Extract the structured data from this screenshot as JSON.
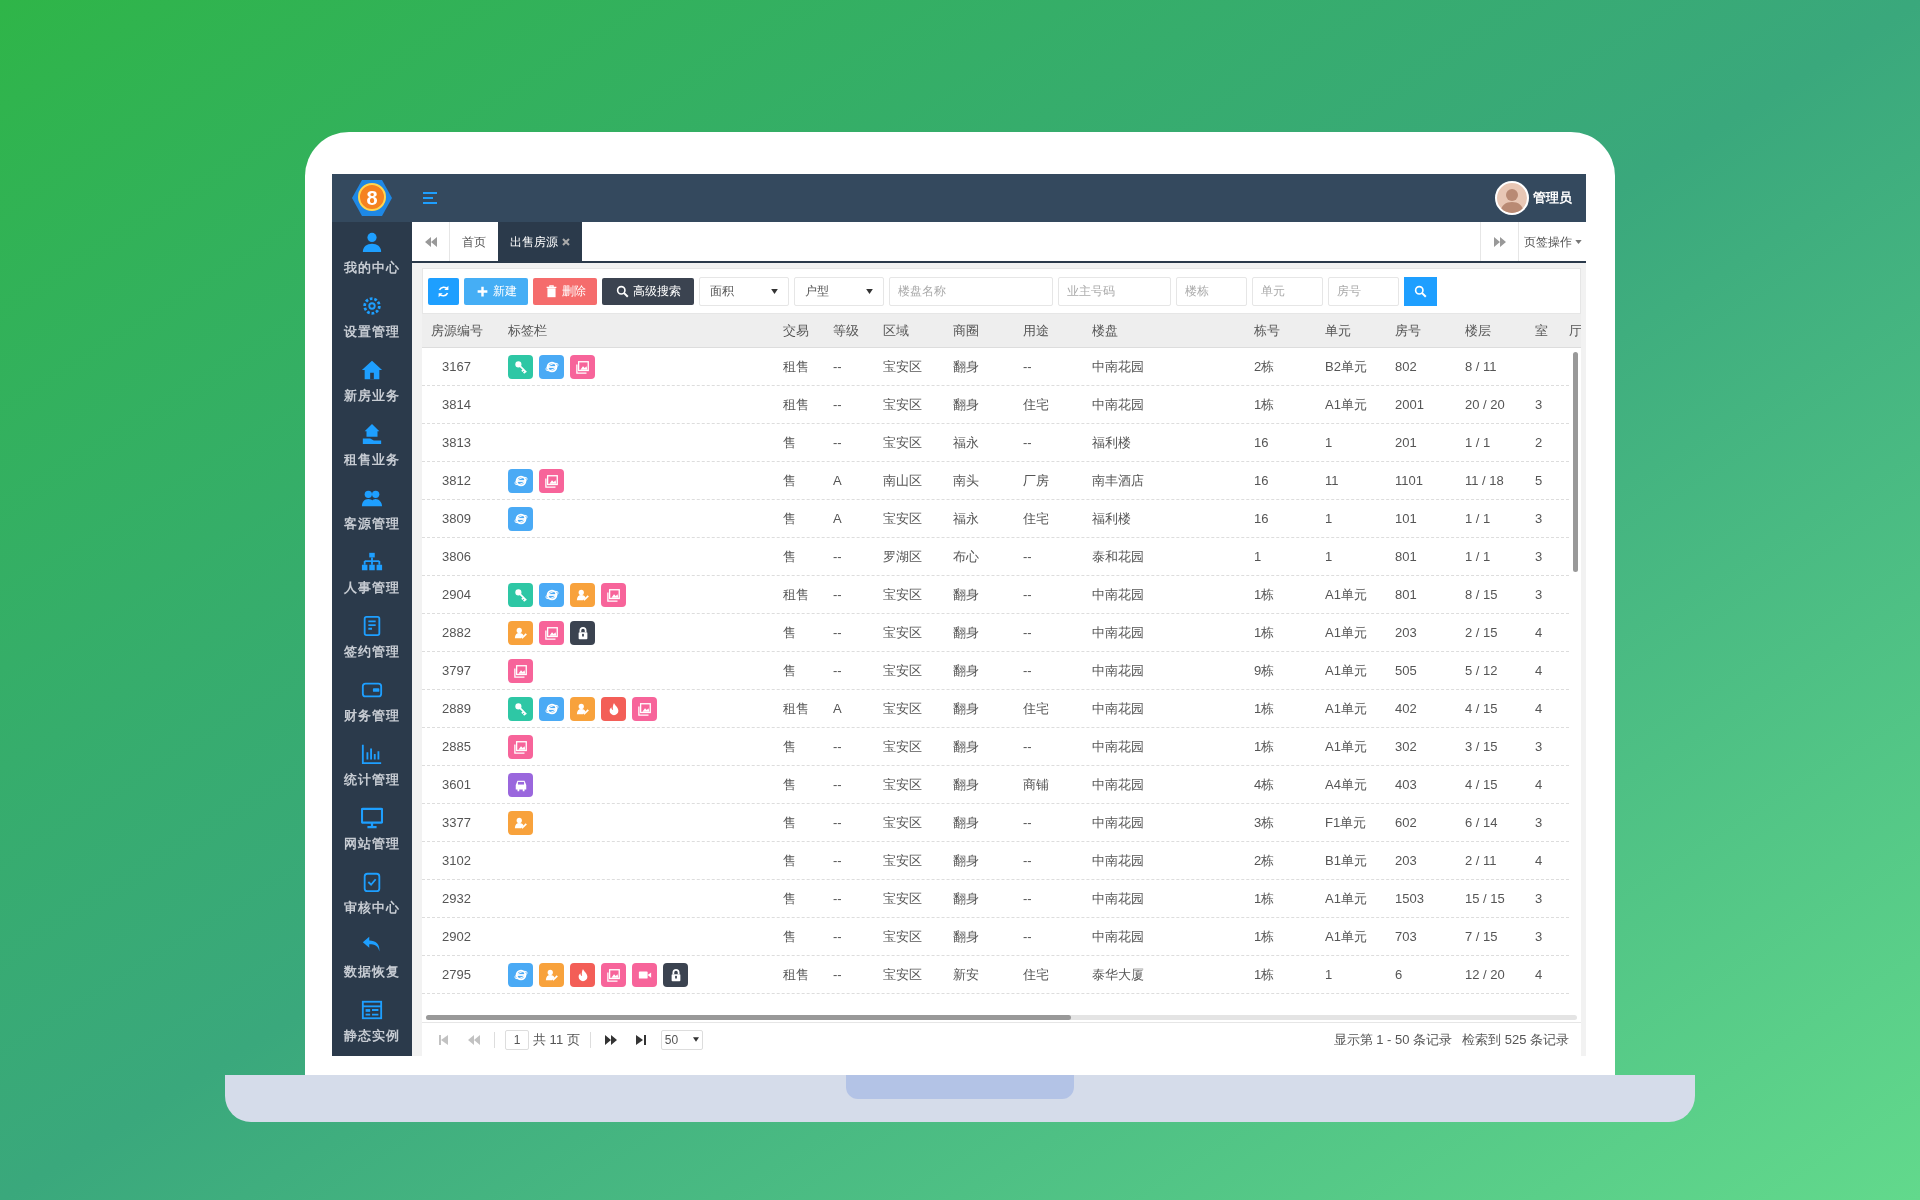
{
  "header": {
    "logo_text": "8",
    "user_name": "管理员"
  },
  "sidebar": {
    "items": [
      {
        "label": "我的中心"
      },
      {
        "label": "设置管理"
      },
      {
        "label": "新房业务"
      },
      {
        "label": "租售业务"
      },
      {
        "label": "客源管理"
      },
      {
        "label": "人事管理"
      },
      {
        "label": "签约管理"
      },
      {
        "label": "财务管理"
      },
      {
        "label": "统计管理"
      },
      {
        "label": "网站管理"
      },
      {
        "label": "审核中心"
      },
      {
        "label": "数据恢复"
      },
      {
        "label": "静态实例"
      }
    ]
  },
  "tabs": [
    {
      "label": "首页",
      "selected": false,
      "closable": false
    },
    {
      "label": "出售房源",
      "selected": true,
      "closable": true
    }
  ],
  "tab_actions": {
    "label": "页签操作"
  },
  "toolbar": {
    "buttons": [
      {
        "kind": "refresh"
      },
      {
        "kind": "new",
        "label": "新建"
      },
      {
        "kind": "delete",
        "label": "删除"
      },
      {
        "kind": "advanced",
        "label": "高级搜索"
      }
    ],
    "selects": [
      {
        "value": "面积"
      },
      {
        "value": "户型"
      }
    ],
    "inputs": [
      {
        "placeholder": "楼盘名称"
      },
      {
        "placeholder": "业主号码"
      },
      {
        "placeholder": "楼栋"
      },
      {
        "placeholder": "单元"
      },
      {
        "placeholder": "房号"
      }
    ]
  },
  "table": {
    "columns": [
      "房源编号",
      "标签栏",
      "交易",
      "等级",
      "区域",
      "商圈",
      "用途",
      "楼盘",
      "栋号",
      "单元",
      "房号",
      "楼层",
      "室",
      "厅"
    ],
    "rows": [
      {
        "cells": [
          "3167",
          {
            "kind": "tag_list",
            "tags": [
              {
                "kind": "key"
              },
              {
                "kind": "ie"
              },
              {
                "kind": "image"
              }
            ]
          },
          "租售",
          "--",
          "宝安区",
          "翻身",
          "--",
          "中南花园",
          "2栋",
          "B2单元",
          "802",
          "8 / 11"
        ]
      },
      {
        "cells": [
          "3814",
          {
            "kind": "tag_list"
          },
          "租售",
          "--",
          "宝安区",
          "翻身",
          "住宅",
          "中南花园",
          "1栋",
          "A1单元",
          "2001",
          "20 / 20",
          "3"
        ]
      },
      {
        "cells": [
          "3813",
          {
            "kind": "tag_list"
          },
          "售",
          "--",
          "宝安区",
          "福永",
          "--",
          "福利楼",
          "16",
          "1",
          "201",
          "1 / 1",
          "2"
        ]
      },
      {
        "cells": [
          "3812",
          {
            "kind": "tag_list",
            "tags": [
              {
                "kind": "ie"
              },
              {
                "kind": "image"
              }
            ]
          },
          "售",
          "A",
          "南山区",
          "南头",
          "厂房",
          "南丰酒店",
          "16",
          "11",
          "1101",
          "11 / 18",
          "5"
        ]
      },
      {
        "cells": [
          "3809",
          {
            "kind": "tag_list",
            "tags": [
              {
                "kind": "ie"
              }
            ]
          },
          "售",
          "A",
          "宝安区",
          "福永",
          "住宅",
          "福利楼",
          "16",
          "1",
          "101",
          "1 / 1",
          "3"
        ]
      },
      {
        "cells": [
          "3806",
          {
            "kind": "tag_list"
          },
          "售",
          "--",
          "罗湖区",
          "布心",
          "--",
          "泰和花园",
          "1",
          "1",
          "801",
          "1 / 1",
          "3"
        ]
      },
      {
        "cells": [
          "2904",
          {
            "kind": "tag_list",
            "tags": [
              {
                "kind": "key"
              },
              {
                "kind": "ie"
              },
              {
                "kind": "person"
              },
              {
                "kind": "image"
              }
            ]
          },
          "租售",
          "--",
          "宝安区",
          "翻身",
          "--",
          "中南花园",
          "1栋",
          "A1单元",
          "801",
          "8 / 15",
          "3"
        ]
      },
      {
        "cells": [
          "2882",
          {
            "kind": "tag_list",
            "tags": [
              {
                "kind": "person"
              },
              {
                "kind": "image"
              },
              {
                "kind": "lock"
              }
            ]
          },
          "售",
          "--",
          "宝安区",
          "翻身",
          "--",
          "中南花园",
          "1栋",
          "A1单元",
          "203",
          "2 / 15",
          "4"
        ]
      },
      {
        "cells": [
          "3797",
          {
            "kind": "tag_list",
            "tags": [
              {
                "kind": "image"
              }
            ]
          },
          "售",
          "--",
          "宝安区",
          "翻身",
          "--",
          "中南花园",
          "9栋",
          "A1单元",
          "505",
          "5 / 12",
          "4"
        ]
      },
      {
        "cells": [
          "2889",
          {
            "kind": "tag_list",
            "tags": [
              {
                "kind": "key"
              },
              {
                "kind": "ie"
              },
              {
                "kind": "person"
              },
              {
                "kind": "fire"
              },
              {
                "kind": "image"
              }
            ]
          },
          "租售",
          "A",
          "宝安区",
          "翻身",
          "住宅",
          "中南花园",
          "1栋",
          "A1单元",
          "402",
          "4 / 15",
          "4"
        ]
      },
      {
        "cells": [
          "2885",
          {
            "kind": "tag_list",
            "tags": [
              {
                "kind": "image"
              }
            ]
          },
          "售",
          "--",
          "宝安区",
          "翻身",
          "--",
          "中南花园",
          "1栋",
          "A1单元",
          "302",
          "3 / 15",
          "3"
        ]
      },
      {
        "cells": [
          "3601",
          {
            "kind": "tag_list",
            "tags": [
              {
                "kind": "car"
              }
            ]
          },
          "售",
          "--",
          "宝安区",
          "翻身",
          "商铺",
          "中南花园",
          "4栋",
          "A4单元",
          "403",
          "4 / 15",
          "4"
        ]
      },
      {
        "cells": [
          "3377",
          {
            "kind": "tag_list",
            "tags": [
              {
                "kind": "person"
              }
            ]
          },
          "售",
          "--",
          "宝安区",
          "翻身",
          "--",
          "中南花园",
          "3栋",
          "F1单元",
          "602",
          "6 / 14",
          "3"
        ]
      },
      {
        "cells": [
          "3102",
          {
            "kind": "tag_list"
          },
          "售",
          "--",
          "宝安区",
          "翻身",
          "--",
          "中南花园",
          "2栋",
          "B1单元",
          "203",
          "2 / 11",
          "4"
        ]
      },
      {
        "cells": [
          "2932",
          {
            "kind": "tag_list"
          },
          "售",
          "--",
          "宝安区",
          "翻身",
          "--",
          "中南花园",
          "1栋",
          "A1单元",
          "1503",
          "15 / 15",
          "3"
        ]
      },
      {
        "cells": [
          "2902",
          {
            "kind": "tag_list"
          },
          "售",
          "--",
          "宝安区",
          "翻身",
          "--",
          "中南花园",
          "1栋",
          "A1单元",
          "703",
          "7 / 15",
          "3"
        ]
      },
      {
        "cells": [
          "2795",
          {
            "kind": "tag_list",
            "tags": [
              {
                "kind": "ie"
              },
              {
                "kind": "person"
              },
              {
                "kind": "fire"
              },
              {
                "kind": "image"
              },
              {
                "kind": "video"
              },
              {
                "kind": "lock"
              }
            ]
          },
          "租售",
          "--",
          "宝安区",
          "新安",
          "住宅",
          "泰华大厦",
          "1栋",
          "1",
          "6",
          "12 / 20",
          "4"
        ]
      }
    ]
  },
  "pager": {
    "buttons": [
      {
        "kind": "first",
        "disabled": true
      },
      {
        "kind": "prev",
        "disabled": true
      }
    ],
    "page": "1",
    "total_pages_text": "共 11 页",
    "next_buttons": [
      {
        "kind": "next",
        "disabled": false
      },
      {
        "kind": "last",
        "disabled": false
      }
    ],
    "page_size": "50",
    "showing": "显示第 1 - 50 条记录",
    "found": "检索到 525 条记录"
  }
}
